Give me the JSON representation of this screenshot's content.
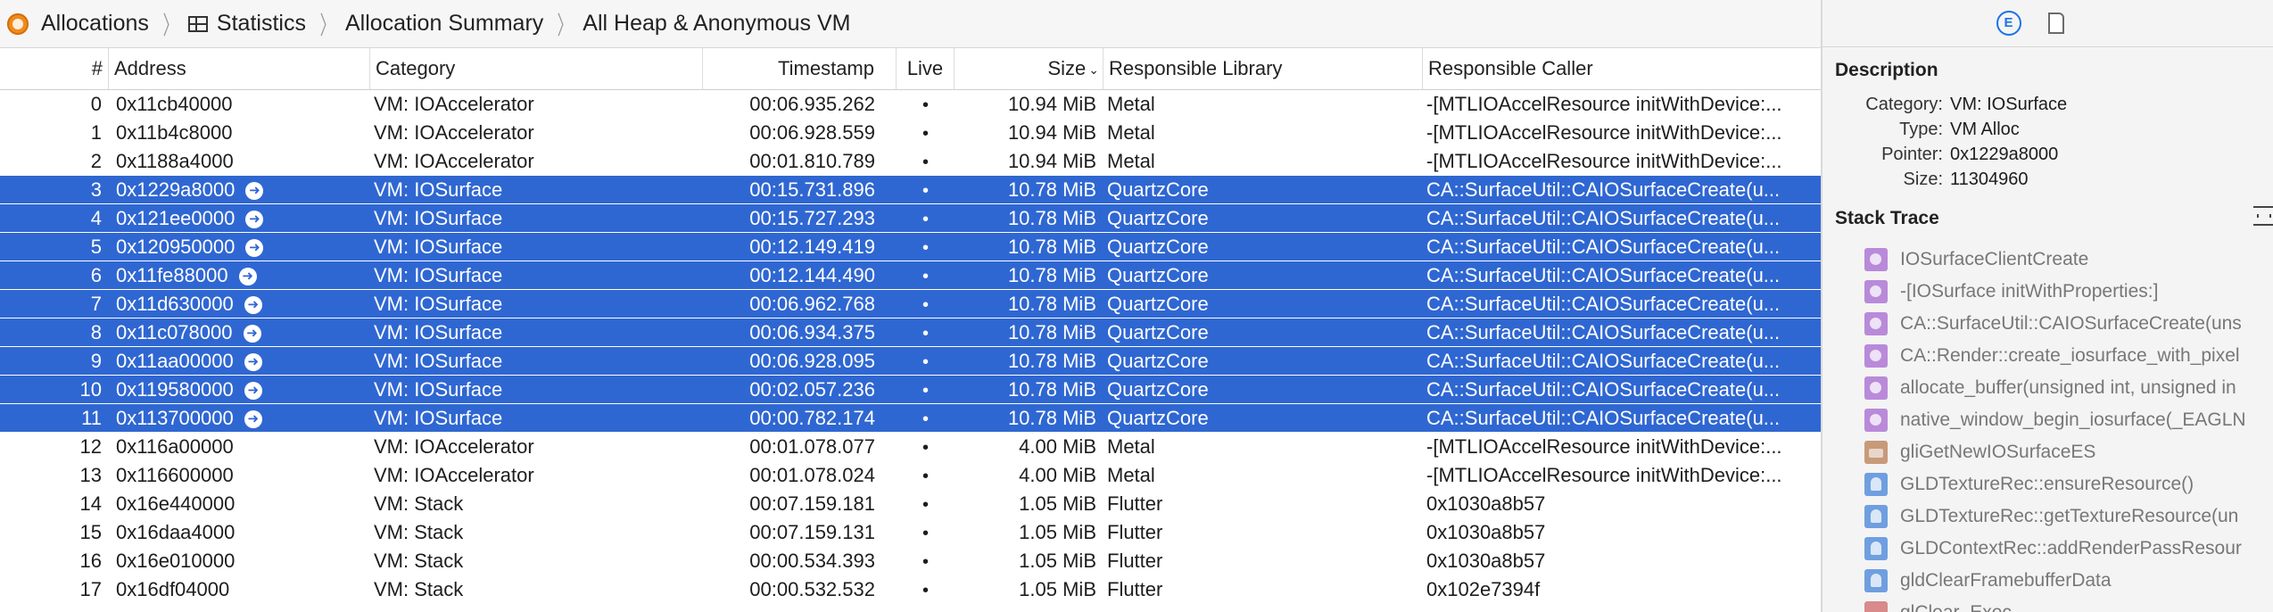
{
  "breadcrumb": {
    "items": [
      "Allocations",
      "Statistics",
      "Allocation Summary",
      "All Heap & Anonymous VM"
    ]
  },
  "columns": {
    "index": "#",
    "address": "Address",
    "category": "Category",
    "timestamp": "Timestamp",
    "live": "Live",
    "size": "Size",
    "library": "Responsible Library",
    "caller": "Responsible Caller"
  },
  "rows": [
    {
      "index": "0",
      "address": "0x11cb40000",
      "category": "VM: IOAccelerator",
      "timestamp": "00:06.935.262",
      "live": "•",
      "size": "10.94 MiB",
      "library": "Metal",
      "caller": "-[MTLIOAccelResource initWithDevice:...",
      "selected": false
    },
    {
      "index": "1",
      "address": "0x11b4c8000",
      "category": "VM: IOAccelerator",
      "timestamp": "00:06.928.559",
      "live": "•",
      "size": "10.94 MiB",
      "library": "Metal",
      "caller": "-[MTLIOAccelResource initWithDevice:...",
      "selected": false
    },
    {
      "index": "2",
      "address": "0x1188a4000",
      "category": "VM: IOAccelerator",
      "timestamp": "00:01.810.789",
      "live": "•",
      "size": "10.94 MiB",
      "library": "Metal",
      "caller": "-[MTLIOAccelResource initWithDevice:...",
      "selected": false
    },
    {
      "index": "3",
      "address": "0x1229a8000",
      "category": "VM: IOSurface",
      "timestamp": "00:15.731.896",
      "live": "•",
      "size": "10.78 MiB",
      "library": "QuartzCore",
      "caller": "CA::SurfaceUtil::CAIOSurfaceCreate(u...",
      "selected": true
    },
    {
      "index": "4",
      "address": "0x121ee0000",
      "category": "VM: IOSurface",
      "timestamp": "00:15.727.293",
      "live": "•",
      "size": "10.78 MiB",
      "library": "QuartzCore",
      "caller": "CA::SurfaceUtil::CAIOSurfaceCreate(u...",
      "selected": true
    },
    {
      "index": "5",
      "address": "0x120950000",
      "category": "VM: IOSurface",
      "timestamp": "00:12.149.419",
      "live": "•",
      "size": "10.78 MiB",
      "library": "QuartzCore",
      "caller": "CA::SurfaceUtil::CAIOSurfaceCreate(u...",
      "selected": true
    },
    {
      "index": "6",
      "address": "0x11fe88000",
      "category": "VM: IOSurface",
      "timestamp": "00:12.144.490",
      "live": "•",
      "size": "10.78 MiB",
      "library": "QuartzCore",
      "caller": "CA::SurfaceUtil::CAIOSurfaceCreate(u...",
      "selected": true
    },
    {
      "index": "7",
      "address": "0x11d630000",
      "category": "VM: IOSurface",
      "timestamp": "00:06.962.768",
      "live": "•",
      "size": "10.78 MiB",
      "library": "QuartzCore",
      "caller": "CA::SurfaceUtil::CAIOSurfaceCreate(u...",
      "selected": true
    },
    {
      "index": "8",
      "address": "0x11c078000",
      "category": "VM: IOSurface",
      "timestamp": "00:06.934.375",
      "live": "•",
      "size": "10.78 MiB",
      "library": "QuartzCore",
      "caller": "CA::SurfaceUtil::CAIOSurfaceCreate(u...",
      "selected": true
    },
    {
      "index": "9",
      "address": "0x11aa00000",
      "category": "VM: IOSurface",
      "timestamp": "00:06.928.095",
      "live": "•",
      "size": "10.78 MiB",
      "library": "QuartzCore",
      "caller": "CA::SurfaceUtil::CAIOSurfaceCreate(u...",
      "selected": true
    },
    {
      "index": "10",
      "address": "0x119580000",
      "category": "VM: IOSurface",
      "timestamp": "00:02.057.236",
      "live": "•",
      "size": "10.78 MiB",
      "library": "QuartzCore",
      "caller": "CA::SurfaceUtil::CAIOSurfaceCreate(u...",
      "selected": true
    },
    {
      "index": "11",
      "address": "0x113700000",
      "category": "VM: IOSurface",
      "timestamp": "00:00.782.174",
      "live": "•",
      "size": "10.78 MiB",
      "library": "QuartzCore",
      "caller": "CA::SurfaceUtil::CAIOSurfaceCreate(u...",
      "selected": true
    },
    {
      "index": "12",
      "address": "0x116a00000",
      "category": "VM: IOAccelerator",
      "timestamp": "00:01.078.077",
      "live": "•",
      "size": "4.00 MiB",
      "library": "Metal",
      "caller": "-[MTLIOAccelResource initWithDevice:...",
      "selected": false
    },
    {
      "index": "13",
      "address": "0x116600000",
      "category": "VM: IOAccelerator",
      "timestamp": "00:01.078.024",
      "live": "•",
      "size": "4.00 MiB",
      "library": "Metal",
      "caller": "-[MTLIOAccelResource initWithDevice:...",
      "selected": false
    },
    {
      "index": "14",
      "address": "0x16e440000",
      "category": "VM: Stack",
      "timestamp": "00:07.159.181",
      "live": "•",
      "size": "1.05 MiB",
      "library": "Flutter",
      "caller": "0x1030a8b57",
      "selected": false
    },
    {
      "index": "15",
      "address": "0x16daa4000",
      "category": "VM: Stack",
      "timestamp": "00:07.159.131",
      "live": "•",
      "size": "1.05 MiB",
      "library": "Flutter",
      "caller": "0x1030a8b57",
      "selected": false
    },
    {
      "index": "16",
      "address": "0x16e010000",
      "category": "VM: Stack",
      "timestamp": "00:00.534.393",
      "live": "•",
      "size": "1.05 MiB",
      "library": "Flutter",
      "caller": "0x1030a8b57",
      "selected": false
    },
    {
      "index": "17",
      "address": "0x16df04000",
      "category": "VM: Stack",
      "timestamp": "00:00.532.532",
      "live": "•",
      "size": "1.05 MiB",
      "library": "Flutter",
      "caller": "0x102e7394f",
      "selected": false
    }
  ],
  "inspector": {
    "description_title": "Description",
    "details": [
      {
        "key": "Category:",
        "value": "VM: IOSurface"
      },
      {
        "key": "Type:",
        "value": "VM Alloc"
      },
      {
        "key": "Pointer:",
        "value": "0x1229a8000"
      },
      {
        "key": "Size:",
        "value": "11304960"
      }
    ],
    "stack_title": "Stack Trace",
    "frames": [
      {
        "label": "IOSurfaceClientCreate",
        "icon": "purple"
      },
      {
        "label": "-[IOSurface initWithProperties:]",
        "icon": "purple"
      },
      {
        "label": "CA::SurfaceUtil::CAIOSurfaceCreate(uns",
        "icon": "purple"
      },
      {
        "label": "CA::Render::create_iosurface_with_pixel",
        "icon": "purple"
      },
      {
        "label": "allocate_buffer(unsigned int, unsigned in",
        "icon": "purple"
      },
      {
        "label": "native_window_begin_iosurface(_EAGLN",
        "icon": "purple"
      },
      {
        "label": "gliGetNewIOSurfaceES",
        "icon": "tan"
      },
      {
        "label": "GLDTextureRec::ensureResource()",
        "icon": "blue"
      },
      {
        "label": "GLDTextureRec::getTextureResource(un",
        "icon": "blue"
      },
      {
        "label": "GLDContextRec::addRenderPassResour",
        "icon": "blue"
      },
      {
        "label": "gldClearFramebufferData",
        "icon": "blue"
      },
      {
        "label": "glClear_Exec",
        "icon": "pink"
      }
    ]
  },
  "colors": {
    "selection": "#2f67d2",
    "accent": "#1a73e8"
  }
}
